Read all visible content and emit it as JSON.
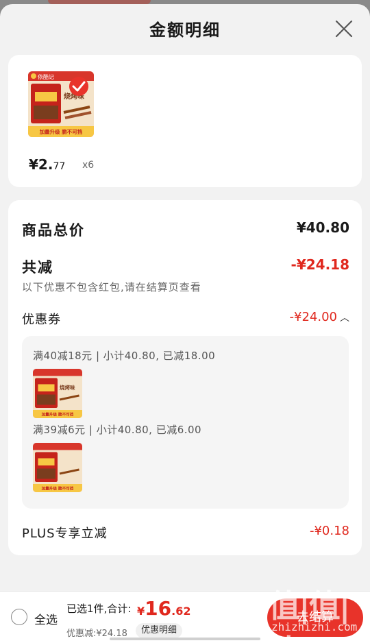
{
  "sheet": {
    "title": "金额明细",
    "close_icon": "close-icon"
  },
  "product": {
    "price_int": "¥2.",
    "price_dec": "77",
    "quantity": "x6",
    "thumb": {
      "brand": "依酷记",
      "flavor": "烧烤味",
      "banner": "加量升级 脆不可挡",
      "checked": true
    }
  },
  "detail": {
    "subtotal_label": "商品总价",
    "subtotal_value": "¥40.80",
    "reduce_label": "共减",
    "reduce_value": "-¥24.18",
    "reduce_note": "以下优惠不包含红包,请在结算页查看",
    "coupon_label": "优惠券",
    "coupon_value": "-¥24.00",
    "coupon_chevron_icon": "chevron-up-icon",
    "coupons": [
      {
        "text": "满40减18元 | 小计40.80, 已减18.00"
      },
      {
        "text": "满39减6元 | 小计40.80, 已减6.00"
      }
    ],
    "plus_label": "PLUS专享立减",
    "plus_value": "-¥0.18"
  },
  "bottom": {
    "select_all": "全选",
    "summary": "已选1件,合计:",
    "total_yen": "¥",
    "total_int": "16",
    "total_dec": ".62",
    "discount": "优惠减:¥24.18",
    "detail_link": "优惠明细",
    "checkout": "去结算"
  },
  "watermark": {
    "main": "值|值|值",
    "sub": "zhizhizhi.com"
  },
  "colors": {
    "accent_red": "#e0281e",
    "checkout_red": "#e8332a",
    "sheet_bg": "#f2f2f2"
  }
}
